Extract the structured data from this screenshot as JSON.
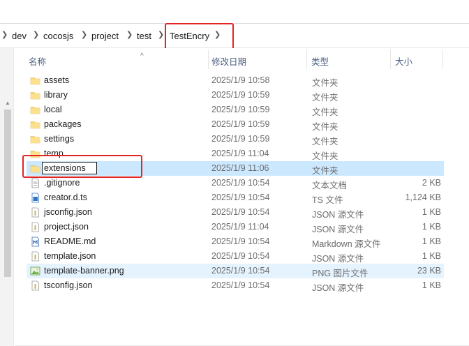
{
  "breadcrumb": {
    "items": [
      {
        "label": "dev"
      },
      {
        "label": "cocosjs"
      },
      {
        "label": "project"
      },
      {
        "label": "test"
      },
      {
        "label": "TestEncry"
      }
    ]
  },
  "columns": {
    "name": "名称",
    "date": "修改日期",
    "type": "类型",
    "size": "大小"
  },
  "rename": {
    "value": "extensions"
  },
  "files": [
    {
      "name": "assets",
      "date": "2025/1/9 10:58",
      "type": "文件夹",
      "size": "",
      "icon": "folder-icon"
    },
    {
      "name": "library",
      "date": "2025/1/9 10:59",
      "type": "文件夹",
      "size": "",
      "icon": "folder-icon"
    },
    {
      "name": "local",
      "date": "2025/1/9 10:59",
      "type": "文件夹",
      "size": "",
      "icon": "folder-icon"
    },
    {
      "name": "packages",
      "date": "2025/1/9 10:59",
      "type": "文件夹",
      "size": "",
      "icon": "folder-icon"
    },
    {
      "name": "settings",
      "date": "2025/1/9 10:59",
      "type": "文件夹",
      "size": "",
      "icon": "folder-icon"
    },
    {
      "name": "temp",
      "date": "2025/1/9 11:04",
      "type": "文件夹",
      "size": "",
      "icon": "folder-icon"
    },
    {
      "name": "extensions",
      "date": "2025/1/9 11:06",
      "type": "文件夹",
      "size": "",
      "icon": "folder-icon"
    },
    {
      "name": ".gitignore",
      "date": "2025/1/9 10:54",
      "type": "文本文档",
      "size": "2 KB",
      "icon": "text-file-icon"
    },
    {
      "name": "creator.d.ts",
      "date": "2025/1/9 10:54",
      "type": "TS 文件",
      "size": "1,124 KB",
      "icon": "ts-file-icon"
    },
    {
      "name": "jsconfig.json",
      "date": "2025/1/9 10:54",
      "type": "JSON 源文件",
      "size": "1 KB",
      "icon": "json-file-icon"
    },
    {
      "name": "project.json",
      "date": "2025/1/9 11:04",
      "type": "JSON 源文件",
      "size": "1 KB",
      "icon": "json-file-icon"
    },
    {
      "name": "README.md",
      "date": "2025/1/9 10:54",
      "type": "Markdown 源文件",
      "size": "1 KB",
      "icon": "markdown-file-icon"
    },
    {
      "name": "template.json",
      "date": "2025/1/9 10:54",
      "type": "JSON 源文件",
      "size": "1 KB",
      "icon": "json-file-icon"
    },
    {
      "name": "template-banner.png",
      "date": "2025/1/9 10:54",
      "type": "PNG 图片文件",
      "size": "23 KB",
      "icon": "png-file-icon"
    },
    {
      "name": "tsconfig.json",
      "date": "2025/1/9 10:54",
      "type": "JSON 源文件",
      "size": "1 KB",
      "icon": "json-file-icon"
    }
  ],
  "colors": {
    "selection": "#cce8ff",
    "hover": "#e5f3ff",
    "highlight_box": "#e32424",
    "folder": "#f8d775",
    "header_text": "#4d6082"
  }
}
